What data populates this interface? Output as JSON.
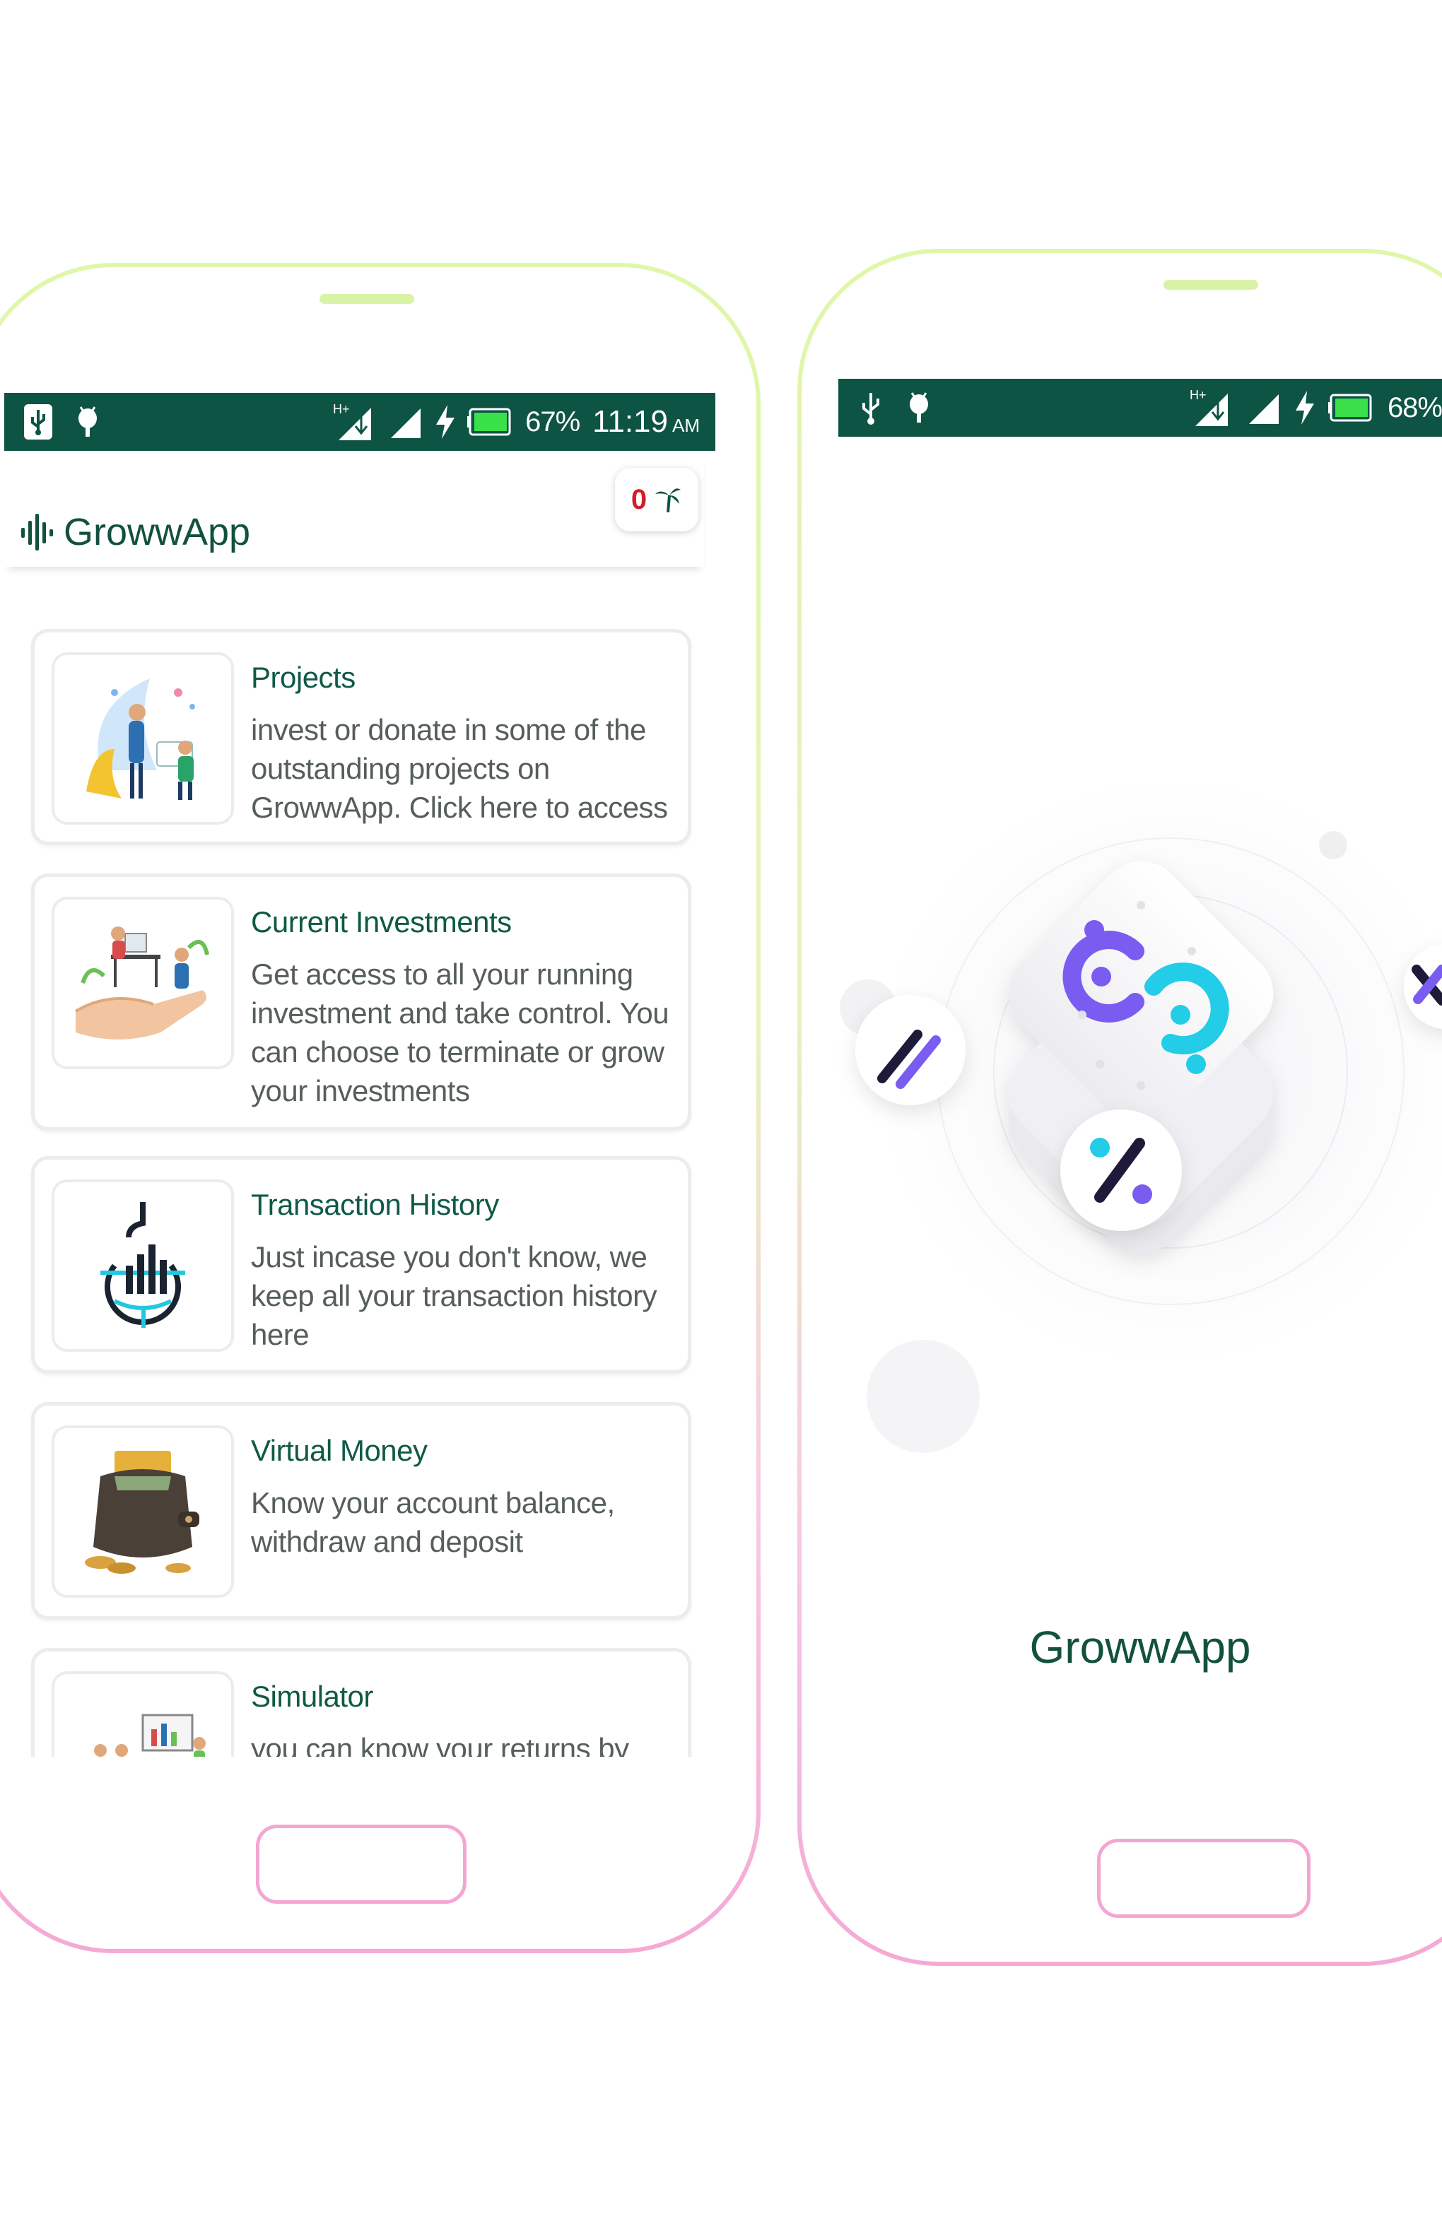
{
  "left_phone": {
    "status_bar": {
      "battery": "67%",
      "time": "11:19",
      "ampm": "AM",
      "network": "H+"
    },
    "app_bar": {
      "title": "GrowwApp",
      "notification_count": "0"
    },
    "menu": [
      {
        "title": "Projects",
        "description": "invest or donate in some of the outstanding projects on GrowwApp. Click here to access",
        "icon": "people-working-illustration"
      },
      {
        "title": "Current Investments",
        "description": "Get access to all your running investment and take control. You can choose to terminate or grow your investments",
        "icon": "hand-holding-business-illustration"
      },
      {
        "title": "Transaction History",
        "description": "Just incase you don't know, we keep all your transaction history here",
        "icon": "bar-chart-history-icon"
      },
      {
        "title": "Virtual Money",
        "description": "Know your account balance, withdraw and deposit",
        "icon": "wallet-cash-illustration"
      },
      {
        "title": "Simulator",
        "description": "you can know your returns by",
        "icon": "presentation-illustration"
      }
    ]
  },
  "right_phone": {
    "status_bar": {
      "battery": "68%",
      "network": "H+"
    },
    "splash_title": "GrowwApp",
    "icons": [
      "growwapp-logo-icon",
      "percent-icon",
      "equals-slash-icon",
      "multiply-icon"
    ]
  },
  "colors": {
    "status_bar": "#0d5444",
    "brand_text": "#13513f",
    "frame_top": "#dff7a8",
    "frame_bottom": "#f5a9d4",
    "logo_purple": "#7b5cf0",
    "logo_cyan": "#23cde8",
    "notification_red": "#d01f2a"
  }
}
